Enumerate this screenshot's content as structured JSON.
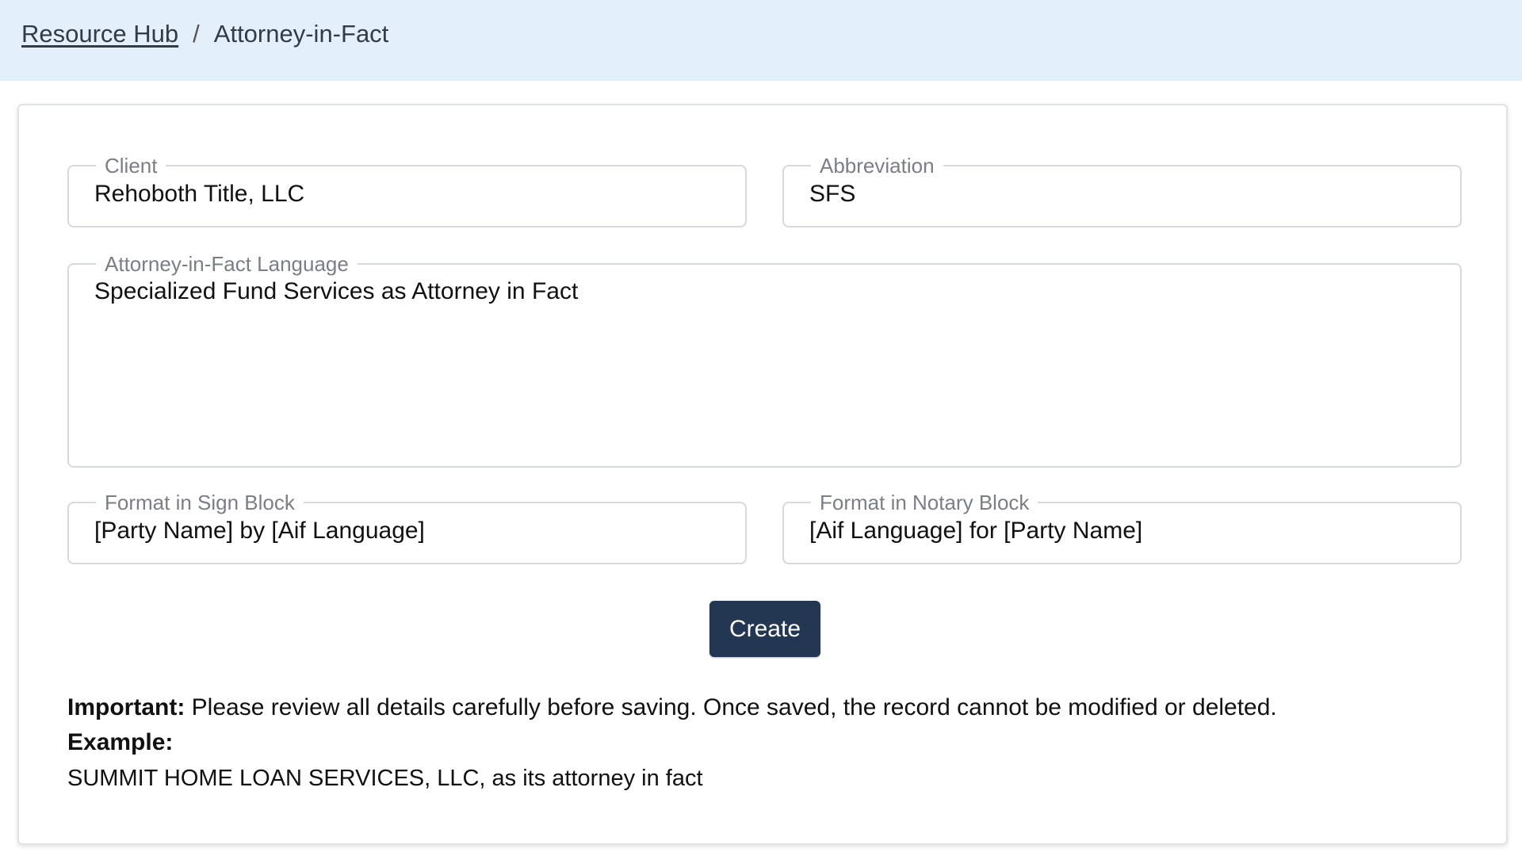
{
  "breadcrumb": {
    "root_link": "Resource Hub",
    "separator": "/",
    "current": "Attorney-in-Fact"
  },
  "form": {
    "client": {
      "label": "Client",
      "value": "Rehoboth Title, LLC"
    },
    "abbreviation": {
      "label": "Abbreviation",
      "value": "SFS"
    },
    "aif_language": {
      "label": "Attorney-in-Fact Language",
      "value": "Specialized Fund Services as Attorney in Fact"
    },
    "sign_block": {
      "label": "Format in Sign Block",
      "value": "[Party Name] by [Aif Language]"
    },
    "notary_block": {
      "label": "Format in Notary Block",
      "value": "[Aif Language] for [Party Name]"
    },
    "create_label": "Create"
  },
  "notes": {
    "important_label": "Important:",
    "important_text": " Please review all details carefully before saving. Once saved, the record cannot be modified or deleted.",
    "example_label": "Example:",
    "example_text": "SUMMIT HOME LOAN SERVICES, LLC, as its attorney in fact"
  },
  "colors": {
    "topbar_bg": "#e3f0fa",
    "button_bg": "#243752",
    "field_border": "#d6d9dd",
    "label_text": "#7a7f86"
  }
}
